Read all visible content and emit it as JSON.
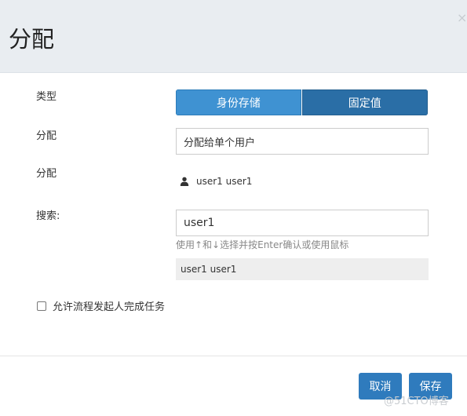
{
  "dialog": {
    "title": "分配",
    "close_glyph": "×"
  },
  "form": {
    "type_label": "类型",
    "type_options": [
      "身份存储",
      "固定值"
    ],
    "type_selected": "身份存储",
    "assign_label": "分配",
    "assign_value": "分配给单个用户",
    "assignee_label": "分配",
    "assignee_icon": "user-icon",
    "assignee_value": "user1 user1",
    "search_label": "搜索:",
    "search_value": "user1",
    "search_hint": "使用↑和↓选择并按Enter确认或使用鼠标",
    "suggestion": "user1 user1",
    "allow_initiator_label": "允许流程发起人完成任务",
    "allow_initiator_checked": false
  },
  "footer": {
    "cancel_label": "取消",
    "save_label": "保存"
  },
  "watermark": "@51CTO博客",
  "colors": {
    "header_bg": "#e9edf1",
    "primary": "#2f7bbd",
    "toggle_active": "#3f92d2",
    "toggle_inactive": "#2a6ea6",
    "suggestion_bg": "#eeeeee"
  }
}
